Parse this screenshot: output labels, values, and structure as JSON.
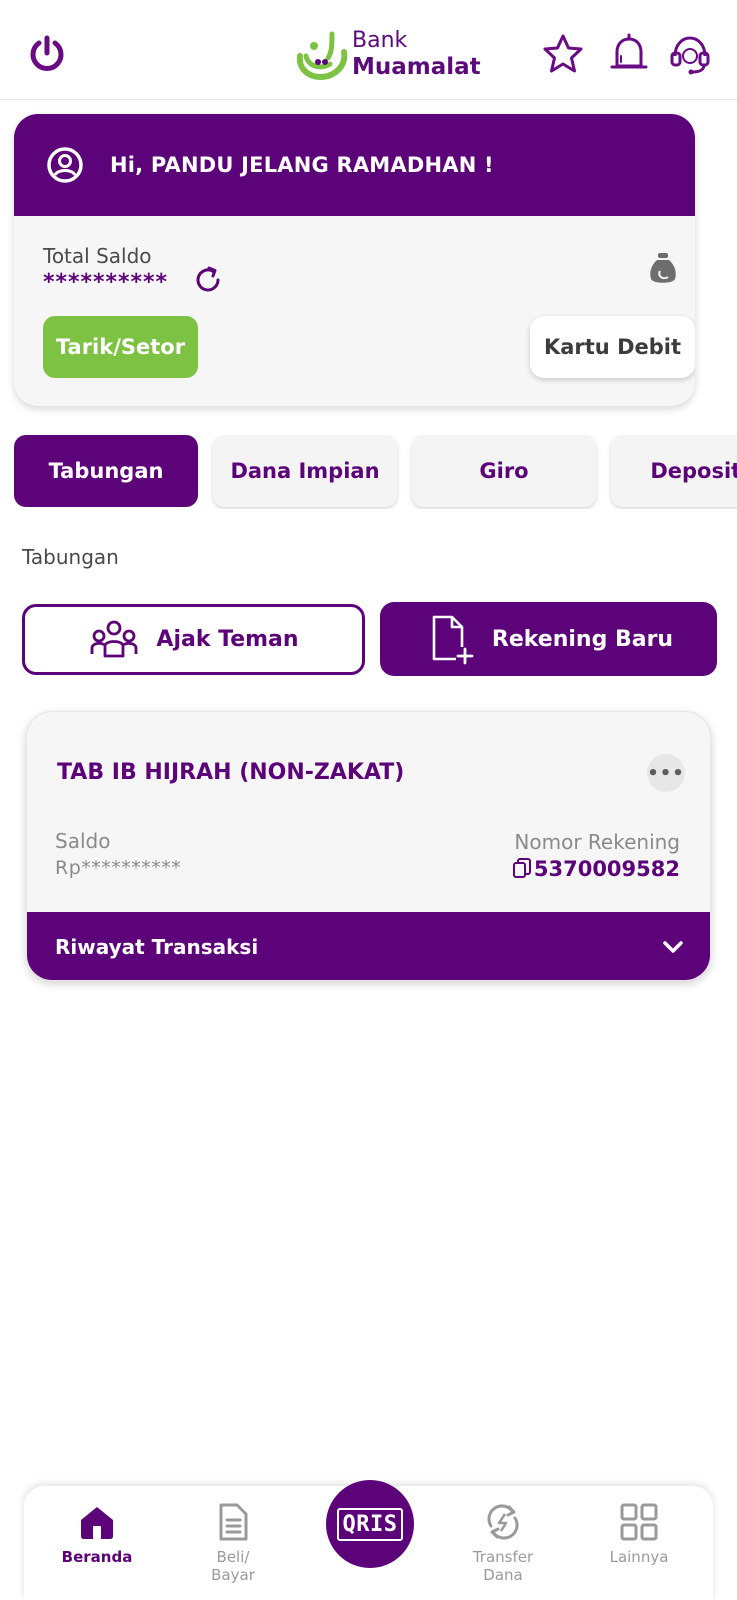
{
  "brand": {
    "line1": "Bank",
    "line2": "Muamalat"
  },
  "colors": {
    "primary": "#5c0379",
    "accent_green": "#7dc242"
  },
  "header_icons": [
    "power-icon",
    "star-icon",
    "bell-icon",
    "headset-icon"
  ],
  "balance": {
    "greeting": "Hi, PANDU JELANG RAMADHAN !",
    "total_label": "Total Saldo",
    "total_value": "**********",
    "tarik_label": "Tarik/Setor",
    "kartu_label": "Kartu Debit"
  },
  "tabs": [
    {
      "label": "Tabungan",
      "active": true
    },
    {
      "label": "Dana Impian",
      "active": false
    },
    {
      "label": "Giro",
      "active": false
    },
    {
      "label": "Deposito",
      "active": false
    }
  ],
  "section_title": "Tabungan",
  "actions": {
    "ajak_label": "Ajak Teman",
    "rekening_label": "Rekening Baru"
  },
  "account": {
    "name": "TAB IB HIJRAH (NON-ZAKAT)",
    "more": "•••",
    "saldo_label": "Saldo",
    "saldo_value": "Rp**********",
    "norek_label": "Nomor Rekening",
    "norek_value": "5370009582",
    "riwayat_label": "Riwayat Transaksi"
  },
  "nav": {
    "beranda": "Beranda",
    "beli": "Beli/\nBayar",
    "qris": "QRIS",
    "transfer": "Transfer\nDana",
    "lainnya": "Lainnya"
  }
}
